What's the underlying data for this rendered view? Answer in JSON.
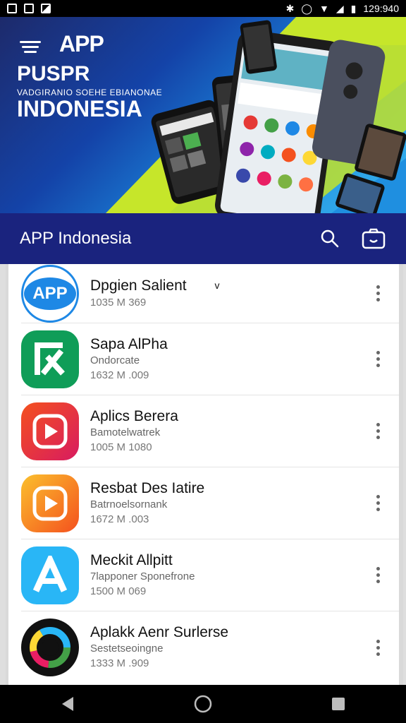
{
  "status_bar": {
    "time": "129:940",
    "left_icons": [
      "square-icon",
      "square-icon",
      "image-icon"
    ],
    "right_icons": [
      "bluetooth-icon",
      "vibrate-icon",
      "wifi-icon",
      "signal-icon",
      "battery-icon"
    ]
  },
  "banner": {
    "logo": "APP",
    "line1": "PUSPR",
    "line2": "VADGIRANIO SOEHE EBIANONAE",
    "line3": "INDONESIA"
  },
  "app_bar": {
    "title": "APP Indonesia",
    "icons": [
      "search-icon",
      "camera-icon"
    ]
  },
  "apps": [
    {
      "name": "Dpgien Salient",
      "suffix": "v",
      "sub": "",
      "meta": "1035 M   369",
      "icon": "app-logo-icon",
      "color": "#1e88e5"
    },
    {
      "name": "Sapa AlPha",
      "sub": "Ondorcate",
      "meta": "1632 M  .009",
      "icon": "green-a-icon",
      "color": "#0f9d58"
    },
    {
      "name": "Aplics Berera",
      "sub": "Bamotelwatrek",
      "meta": "1005 M   1080",
      "icon": "play-icon",
      "color": "#e53935"
    },
    {
      "name": "Resbat Des Iatire",
      "sub": "Batrnoelsornank",
      "meta": "1672 M  .003",
      "icon": "play-icon",
      "color": "#fb8c00"
    },
    {
      "name": "Meckit Allpitt",
      "sub": "7lapponer Sponefrone",
      "meta": "1500 M   069",
      "icon": "letter-a-icon",
      "color": "#29b6f6"
    },
    {
      "name": "Aplakk Aenr Surlerse",
      "sub": "Sestetseoingne",
      "meta": "1333 M  .909",
      "icon": "ring-icon",
      "color": "#111111"
    }
  ],
  "nav_bar": {
    "icons": [
      "back-icon",
      "home-icon",
      "recents-icon"
    ]
  }
}
